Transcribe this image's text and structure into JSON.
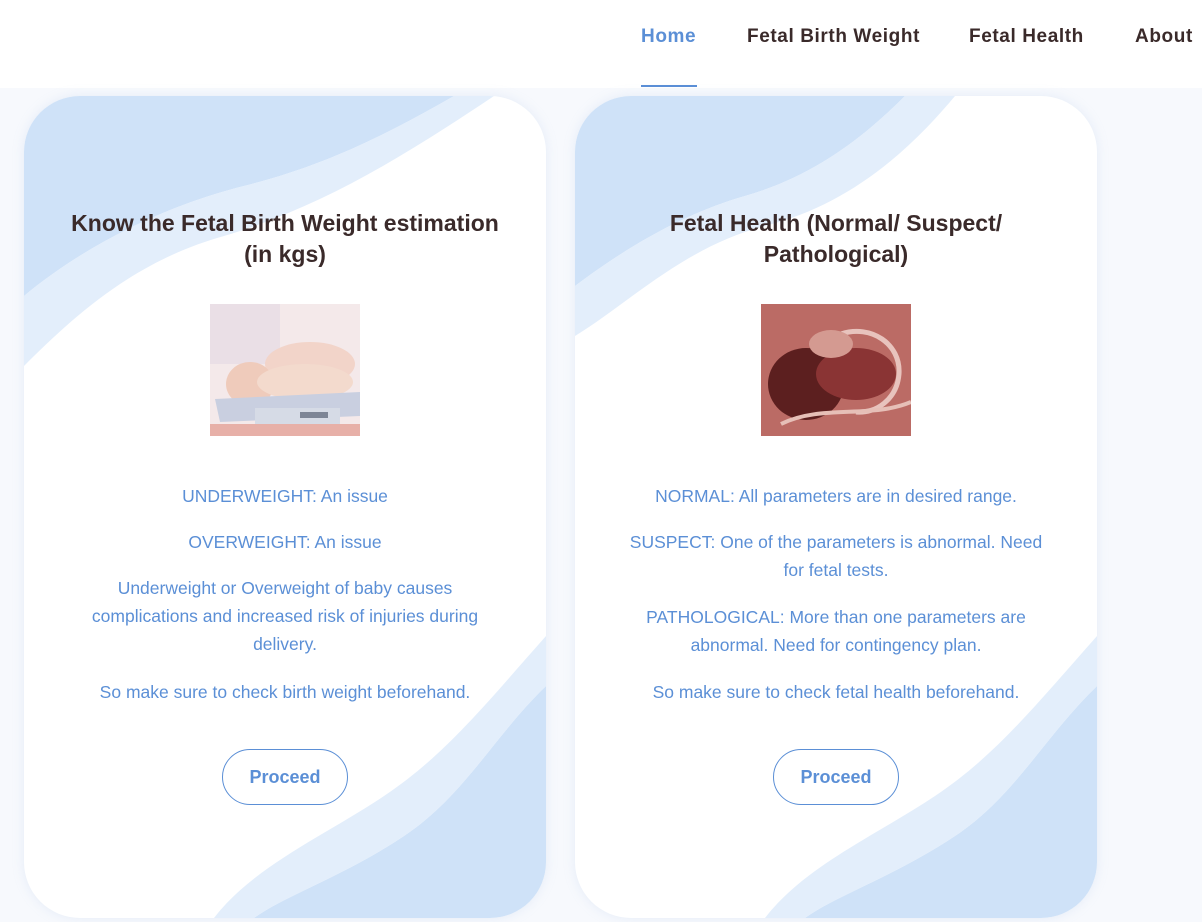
{
  "nav": {
    "items": [
      {
        "label": "Home",
        "active": true
      },
      {
        "label": "Fetal Birth Weight",
        "active": false
      },
      {
        "label": "Fetal Health",
        "active": false
      },
      {
        "label": "About",
        "active": false
      }
    ]
  },
  "cards": [
    {
      "title": "Know the Fetal Birth Weight estimation (in kgs)",
      "image_icon": "baby-on-scale-photo",
      "paragraphs": [
        "UNDERWEIGHT: An issue",
        "OVERWEIGHT: An issue",
        "Underweight or Overweight of baby causes complications and increased risk of injuries during delivery.",
        "So make sure to check birth weight beforehand."
      ],
      "button": "Proceed"
    },
    {
      "title": "Fetal Health (Normal/ Suspect/ Pathological)",
      "image_icon": "fetus-in-womb-photo",
      "paragraphs": [
        "NORMAL: All parameters are in desired range.",
        "SUSPECT: One of the parameters is abnormal. Need for fetal tests.",
        "PATHOLOGICAL: More than one parameters are abnormal. Need for contingency plan.",
        "So make sure to check fetal health beforehand."
      ],
      "button": "Proceed"
    }
  ],
  "colors": {
    "accent": "#5b8fd6",
    "heading": "#3a2a2a",
    "wave_light": "#e3eefb",
    "wave_mid": "#cfe2f8"
  }
}
